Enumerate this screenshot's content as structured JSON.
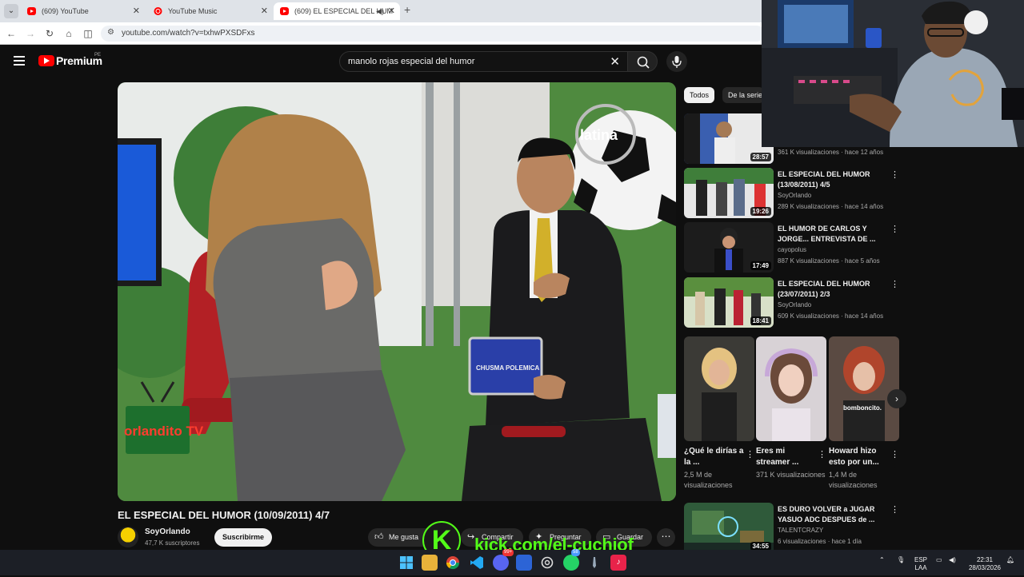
{
  "browser": {
    "tabs": [
      {
        "title": "(609) YouTube",
        "active": false
      },
      {
        "title": "YouTube Music",
        "active": false
      },
      {
        "title": "(609) EL ESPECIAL DEL HUM",
        "active": true
      }
    ],
    "url": "youtube.com/watch?v=txhwPXSDFxs"
  },
  "youtube": {
    "logo_text": "Premium",
    "region": "PE",
    "search_query": "manolo rojas especial del humor",
    "video": {
      "title": "EL ESPECIAL DEL HUMOR (10/09/2011) 4/7",
      "channel": "SoyOrlando",
      "subscribers": "47,7 K suscriptores",
      "subscribe_label": "Suscribirme",
      "overlay_channel_logo": "orlandito TV",
      "overlay_station_logo": "latina",
      "overlay_card_text": "CHUSMA POLEMICA"
    },
    "actions": {
      "like": "Me gusta",
      "share": "Compartir",
      "ask": "Preguntar",
      "save": "Guardar"
    },
    "chips": [
      "Todos",
      "De la serie"
    ],
    "recommendations": [
      {
        "title": "",
        "channel": "",
        "meta": "361 K visualizaciones · hace 12 años",
        "duration": "28:57"
      },
      {
        "title": "EL ESPECIAL DEL HUMOR (13/08/2011) 4/5",
        "channel": "SoyOrlando",
        "meta": "289 K visualizaciones · hace 14 años",
        "duration": "19:26"
      },
      {
        "title": "EL HUMOR DE CARLOS Y JORGE... ENTREVISTA DE ...",
        "channel": "cayopolus",
        "meta": "887 K visualizaciones · hace 5 años",
        "duration": "17:49"
      },
      {
        "title": "EL ESPECIAL DEL HUMOR (23/07/2011) 2/3",
        "channel": "SoyOrlando",
        "meta": "609 K visualizaciones · hace 14 años",
        "duration": "18:41"
      },
      {
        "title": "ES DURO VOLVER a JUGAR YASUO ADC DESPUES de ...",
        "channel": "TALENTCRAZY",
        "meta": "6 visualizaciones · hace 1 día",
        "duration": "34:55"
      }
    ],
    "shorts": [
      {
        "title": "¿Qué le dirías a la ...",
        "views": "2,5 M de visualizaciones",
        "caption": ""
      },
      {
        "title": "Eres mi streamer ...",
        "views": "371 K visualizaciones",
        "caption": ""
      },
      {
        "title": "Howard hizo esto por un...",
        "views": "1,4 M de visualizaciones",
        "caption": "bomboncito."
      }
    ]
  },
  "overlay": {
    "kick_letter": "K",
    "kick_text": "kick.com/el-cuchiof"
  },
  "taskbar": {
    "language": "ESP",
    "layout": "LAA",
    "time": "22:31",
    "date": "28/03/2026",
    "discord_badge": "99+",
    "whatsapp_badge": "58"
  }
}
